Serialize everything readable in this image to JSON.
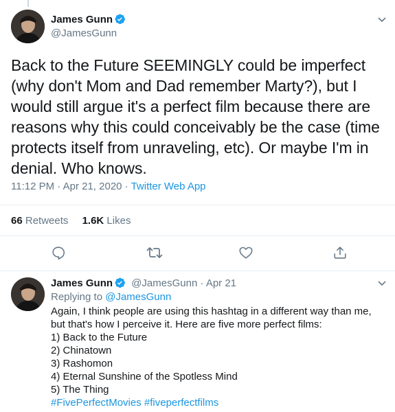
{
  "tweet": {
    "author_name": "James Gunn",
    "author_handle": "@JamesGunn",
    "text": "Back to the Future SEEMINGLY could be imperfect (why don't Mom and Dad remember Marty?), but I would still argue it's a perfect film because there are reasons why this could conceivably be the case (time protects itself from unraveling, etc). Or maybe I'm in denial. Who knows.",
    "time": "11:12 PM",
    "date": "Apr 21, 2020",
    "app": "Twitter Web App",
    "retweets_count": "66",
    "retweets_label": "Retweets",
    "likes_count": "1.6K",
    "likes_label": "Likes"
  },
  "reply": {
    "author_name": "James Gunn",
    "author_handle": "@JamesGunn",
    "date": "Apr 21",
    "replying_label": "Replying to",
    "replying_to": "@JamesGunn",
    "lines": [
      "Again, I think people are using this hashtag in a different way than me, but that's how I perceive it. Here are five more perfect films:",
      "1) Back to the Future",
      "2) Chinatown",
      "3) Rashomon",
      "4) Eternal Sunshine of the Spotless Mind",
      "5) The Thing"
    ],
    "hashtag_1": "#FivePerfectMovies",
    "hashtag_2": "#fiveperfectfilms"
  },
  "colors": {
    "accent": "#1da1f2",
    "link": "#1b95e0",
    "secondary_text": "#657786",
    "divider": "#e6ecf0"
  },
  "icons": [
    "verified-badge-icon",
    "chevron-down-icon",
    "reply-icon",
    "retweet-icon",
    "like-icon",
    "share-icon"
  ]
}
